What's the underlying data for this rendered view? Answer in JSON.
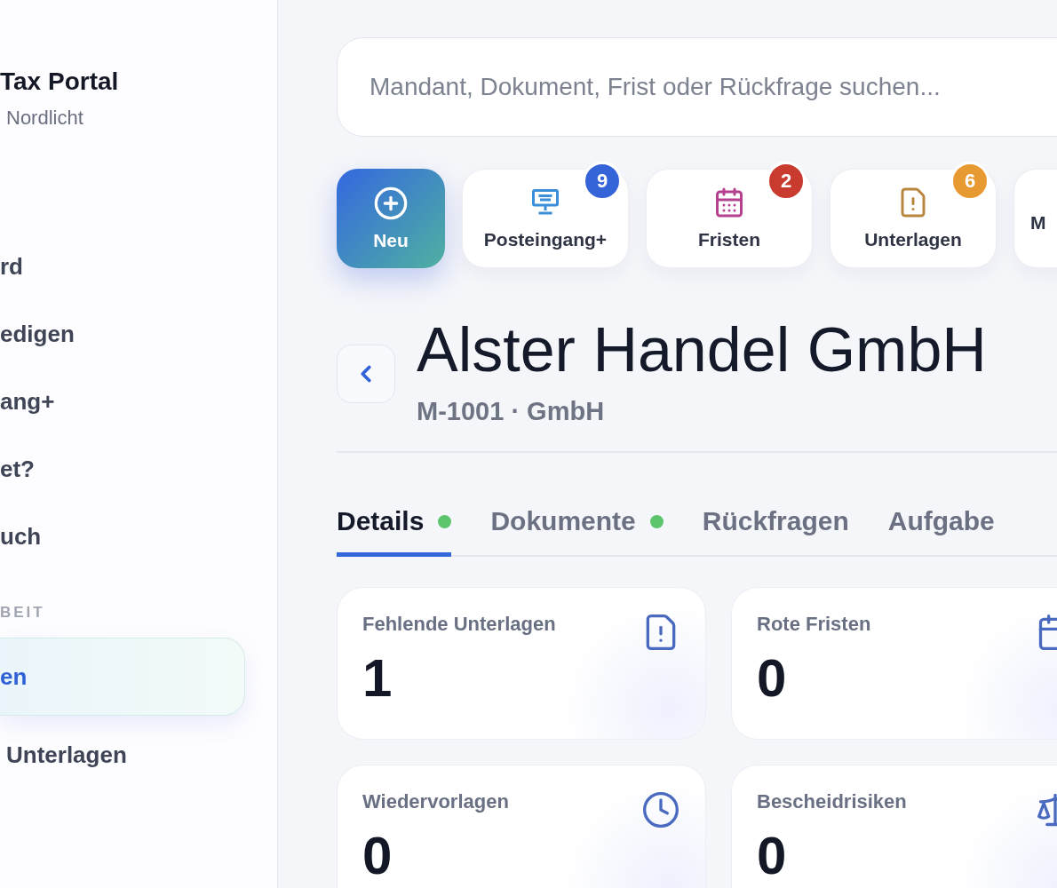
{
  "sidebar": {
    "brand": "Tax Portal",
    "subtitle": "Nordlicht",
    "items": [
      {
        "label": "rd",
        "selected": false
      },
      {
        "label": "edigen",
        "selected": false
      },
      {
        "label": "ang+",
        "selected": false
      },
      {
        "label": "et?",
        "selected": false
      },
      {
        "label": "uch",
        "selected": false
      }
    ],
    "section": "BEIT",
    "section_items": [
      {
        "label": "en",
        "selected": true
      },
      {
        "label": "Unterlagen",
        "selected": false
      }
    ]
  },
  "search": {
    "placeholder": "Mandant, Dokument, Frist oder Rückfrage suchen..."
  },
  "new_button": {
    "label": "Neu"
  },
  "quick_actions": [
    {
      "label": "Posteingang+",
      "kind": "inbox",
      "badge": "9",
      "color": "#3563d8"
    },
    {
      "label": "Fristen",
      "kind": "calendar",
      "badge": "2",
      "color": "#c93a2f"
    },
    {
      "label": "Unterlagen",
      "kind": "document",
      "badge": "6",
      "color": "#e89a32"
    },
    {
      "label": "M"
    }
  ],
  "client": {
    "name": "Alster Handel GmbH",
    "meta": "M-1001 · GmbH"
  },
  "tabs": [
    {
      "label": "Details",
      "selected": true,
      "dot": true
    },
    {
      "label": "Dokumente",
      "selected": false,
      "dot": true
    },
    {
      "label": "Rückfragen",
      "selected": false,
      "dot": false
    },
    {
      "label": "Aufgabe",
      "selected": false,
      "dot": false
    }
  ],
  "cards": [
    {
      "label": "Fehlende Unterlagen",
      "value": "1",
      "kind": "document"
    },
    {
      "label": "Rote Fristen",
      "value": "0",
      "kind": "calendar"
    },
    {
      "label": "Wiedervorlagen",
      "value": "0",
      "kind": "clock"
    },
    {
      "label": "Bescheidrisiken",
      "value": "0",
      "kind": "scale"
    }
  ]
}
